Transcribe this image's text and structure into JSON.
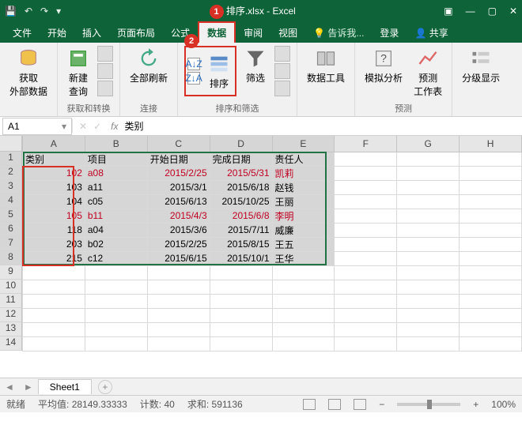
{
  "title_file": "排序.xlsx - Excel",
  "callout1": "1",
  "callout2": "2",
  "tabs": {
    "file": "文件",
    "home": "开始",
    "insert": "插入",
    "layout": "页面布局",
    "formula": "公式",
    "data": "数据",
    "review": "审阅",
    "view": "视图",
    "tell": "告诉我...",
    "login": "登录",
    "share": "共享"
  },
  "ribbon": {
    "ext_data": "获取\n外部数据",
    "new_query": "新建\n查询",
    "refresh": "全部刷新",
    "sort_az": "A↓Z",
    "sort_za": "Z↓A",
    "sort": "排序",
    "filter": "筛选",
    "data_tools": "数据工具",
    "whatif": "模拟分析",
    "forecast": "预测\n工作表",
    "outline": "分级显示",
    "g_get": "获取和转换",
    "g_conn": "连接",
    "g_sortfilter": "排序和筛选",
    "g_forecast": "预测"
  },
  "namebox": "A1",
  "formula": "类别",
  "headers": [
    "类别",
    "项目",
    "开始日期",
    "完成日期",
    "责任人"
  ],
  "rows": [
    {
      "a": "102",
      "b": "a08",
      "c": "2015/2/25",
      "d": "2015/5/31",
      "e": "凯莉",
      "red": true
    },
    {
      "a": "103",
      "b": "a11",
      "c": "2015/3/1",
      "d": "2015/6/18",
      "e": "赵钱",
      "red": false
    },
    {
      "a": "104",
      "b": "c05",
      "c": "2015/6/13",
      "d": "2015/10/25",
      "e": "王丽",
      "red": false
    },
    {
      "a": "105",
      "b": "b11",
      "c": "2015/4/3",
      "d": "2015/6/8",
      "e": "李明",
      "red": true
    },
    {
      "a": "118",
      "b": "a04",
      "c": "2015/3/6",
      "d": "2015/7/11",
      "e": "威廉",
      "red": false
    },
    {
      "a": "203",
      "b": "b02",
      "c": "2015/2/25",
      "d": "2015/8/15",
      "e": "王五",
      "red": false
    },
    {
      "a": "215",
      "b": "c12",
      "c": "2015/6/15",
      "d": "2015/10/1",
      "e": "王华",
      "red": false
    }
  ],
  "sheet": "Sheet1",
  "status": {
    "mode": "就绪",
    "avg_label": "平均值:",
    "avg": "28149.33333",
    "count_label": "计数:",
    "count": "40",
    "sum_label": "求和:",
    "sum": "591136",
    "zoom": "100%"
  },
  "cols": [
    "A",
    "B",
    "C",
    "D",
    "E",
    "F",
    "G",
    "H"
  ]
}
